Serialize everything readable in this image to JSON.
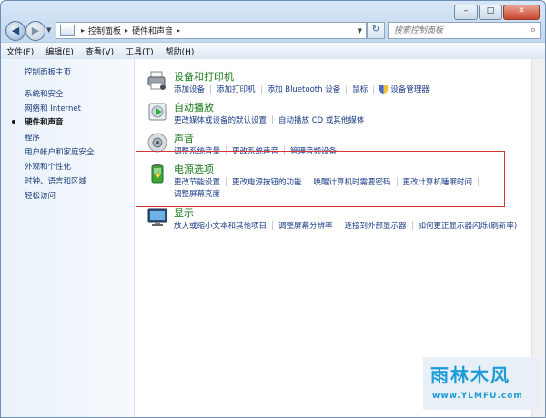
{
  "address": {
    "crumbs": [
      "控制面板",
      "硬件和声音"
    ]
  },
  "search": {
    "placeholder": "搜索控制面板"
  },
  "menu": {
    "items": [
      "文件(F)",
      "编辑(E)",
      "查看(V)",
      "工具(T)",
      "帮助(H)"
    ]
  },
  "sidebar": {
    "items": [
      {
        "label": "控制面板主页",
        "current": false
      },
      {
        "label": "系统和安全",
        "current": false
      },
      {
        "label": "网络和 Internet",
        "current": false
      },
      {
        "label": "硬件和声音",
        "current": true
      },
      {
        "label": "程序",
        "current": false
      },
      {
        "label": "用户帐户和家庭安全",
        "current": false
      },
      {
        "label": "外观和个性化",
        "current": false
      },
      {
        "label": "时钟、语言和区域",
        "current": false
      },
      {
        "label": "轻松访问",
        "current": false
      }
    ]
  },
  "categories": [
    {
      "title": "设备和打印机",
      "icon": "printer-icon",
      "links": [
        "添加设备",
        "添加打印机",
        "添加 Bluetooth 设备",
        "鼠标",
        "设备管理器"
      ]
    },
    {
      "title": "自动播放",
      "icon": "autoplay-icon",
      "links": [
        "更改媒体或设备的默认设置",
        "自动播放 CD 或其他媒体"
      ]
    },
    {
      "title": "声音",
      "icon": "speaker-icon",
      "links": [
        "调整系统音量",
        "更改系统声音",
        "管理音频设备"
      ]
    },
    {
      "title": "电源选项",
      "icon": "battery-icon",
      "links": [
        "更改节能设置",
        "更改电源按钮的功能",
        "唤醒计算机时需要密码",
        "更改计算机睡眠时间"
      ],
      "line2": "调整屏幕亮度"
    },
    {
      "title": "显示",
      "icon": "monitor-icon",
      "links": [
        "放大或缩小文本和其他项目",
        "调整屏幕分辨率",
        "连接到外部显示器",
        "如何更正显示器闪烁(刷新率)"
      ]
    }
  ],
  "watermark": {
    "logo": "雨林木风",
    "url": "www.YLMFU.com"
  }
}
